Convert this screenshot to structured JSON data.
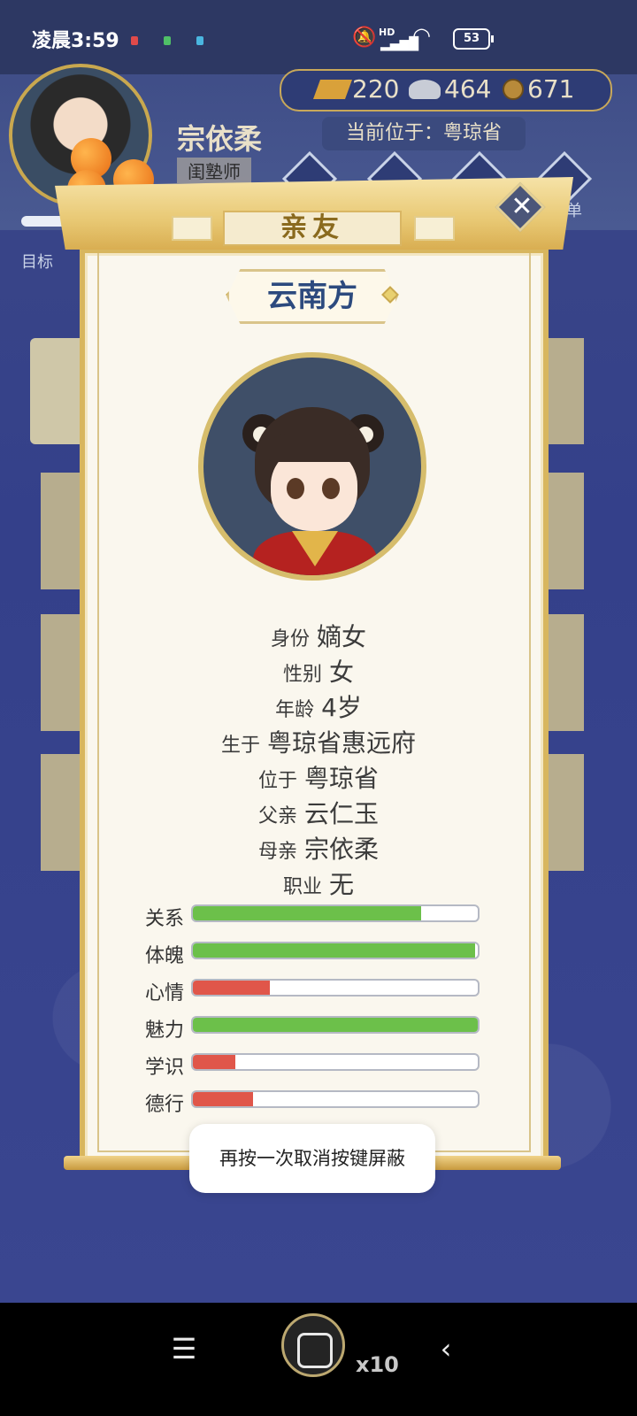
{
  "status_bar": {
    "time": "凌晨3:59",
    "network": "HD",
    "battery": "53"
  },
  "player": {
    "name": "宗依柔",
    "title": "闺塾师",
    "location": "当前位于：粤琼省"
  },
  "currency": {
    "gold": "220",
    "silver": "464",
    "copper": "671"
  },
  "side_labels": {
    "left": "目标",
    "right": "菜单"
  },
  "modal": {
    "tab_title": "亲友",
    "npc_name": "云南方",
    "close_icon": "close-icon",
    "info": [
      {
        "key": "身份",
        "value": "嫡女"
      },
      {
        "key": "性别",
        "value": "女"
      },
      {
        "key": "年龄",
        "value": "4岁"
      },
      {
        "key": "生于",
        "value": "粤琼省惠远府"
      },
      {
        "key": "位于",
        "value": "粤琼省"
      },
      {
        "key": "父亲",
        "value": "云仁玉"
      },
      {
        "key": "母亲",
        "value": "宗依柔"
      },
      {
        "key": "职业",
        "value": "无"
      }
    ],
    "stats": [
      {
        "label": "关系",
        "fill": 0.8,
        "color": "#6cc04a"
      },
      {
        "label": "体魄",
        "fill": 0.99,
        "color": "#6cc04a"
      },
      {
        "label": "心情",
        "fill": 0.27,
        "color": "#e0564a"
      },
      {
        "label": "魅力",
        "fill": 1.0,
        "color": "#6cc04a"
      },
      {
        "label": "学识",
        "fill": 0.15,
        "color": "#e0564a"
      },
      {
        "label": "德行",
        "fill": 0.21,
        "color": "#e0564a"
      }
    ]
  },
  "toast": {
    "message": "再按一次取消按键屏蔽"
  },
  "floating": {
    "count": "x10"
  },
  "nav": {
    "menu_icon": "☰",
    "back_icon": "‹"
  }
}
